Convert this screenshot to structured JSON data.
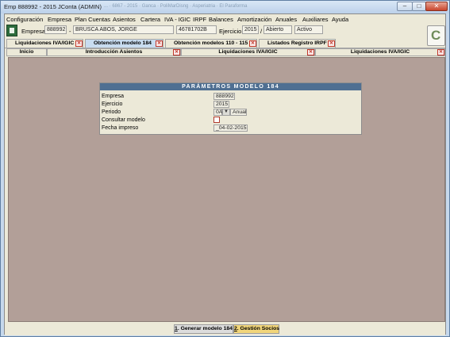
{
  "window": {
    "title": "Emp 888992 - 2015 JConta (ADMIN)",
    "blurred_taskbar_text": "...  · 6867 - 2015  · Ganca  · PoliMarDisng  · Asperiatria  · El Paraforma",
    "min_glyph": "–",
    "max_glyph": "□",
    "close_glyph": "✕"
  },
  "menu": {
    "items": [
      "Configuración",
      "Empresa",
      "Plan Cuentas",
      "Asientos",
      "Cartera",
      "IVA - IGIC",
      "IRPF",
      "Balances",
      "Amortización",
      "Anuales",
      "Auxiliares",
      "Ayuda"
    ]
  },
  "header": {
    "empresa_label": "Empresa",
    "empresa_code": "888992",
    "empresa_name_sep": "-",
    "empresa_name": "BRUSCA ABOS, JORGE",
    "nif": "46781702B",
    "ejercicio_label": "Ejercicio",
    "ejercicio_value": "2015",
    "sep": "/",
    "estado": "Abierto",
    "activo": "Activo"
  },
  "tabs_row1": [
    {
      "label": "Liquidaciones IVA/IGIC",
      "active": false
    },
    {
      "label": "Obtención modelo 184",
      "active": true
    },
    {
      "label": "Obtención modelos 110 - 115",
      "active": false
    },
    {
      "label": "Listados Registro IRPF",
      "active": false
    }
  ],
  "tabs_row2": [
    {
      "label": "Inicio"
    },
    {
      "label": "Introducción Asientos"
    },
    {
      "label": "Liquidaciones IVA/IGIC"
    },
    {
      "label": "Liquidaciones IVA/IGIC"
    }
  ],
  "close_glyph": "✕",
  "panel": {
    "title": "PARÁMETROS MODELO 184",
    "rows": {
      "empresa_label": "Empresa",
      "empresa_value": "888992",
      "ejercicio_label": "Ejercicio",
      "ejercicio_value": "2015",
      "periodo_label": "Periodo",
      "periodo_code": "0A",
      "periodo_arrow": "▼",
      "periodo_text": "Anual",
      "consultar_label": "Consultar modelo",
      "fecha_label": "Fecha impreso",
      "fecha_value": "_04-02-2015"
    }
  },
  "bottom_buttons": {
    "generar_hotkey": "1",
    "generar_label": ". Generar modelo 184",
    "gestion_hotkey": "2",
    "gestion_label": ". Gestión Socios"
  },
  "colors": {
    "panel_header": "#4f6f92",
    "workspace": "#b29f98",
    "active_tab": "#c8dcf0",
    "close_red": "#c0392b",
    "gestion_button": "#f1d57a"
  }
}
